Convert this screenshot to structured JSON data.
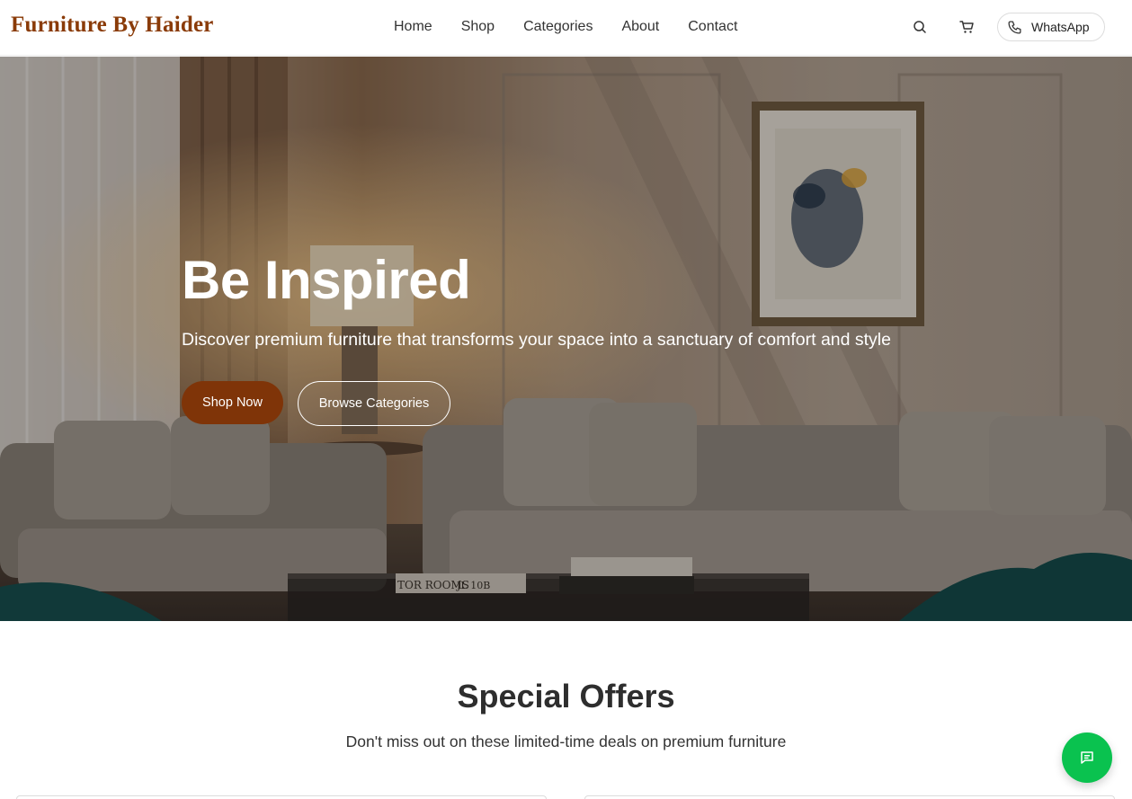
{
  "brand": "Furniture By Haider",
  "nav": {
    "items": [
      "Home",
      "Shop",
      "Categories",
      "About",
      "Contact"
    ]
  },
  "header": {
    "search_icon": "search-icon",
    "cart_icon": "cart-icon",
    "whatsapp_label": "WhatsApp",
    "whatsapp_icon": "phone-icon"
  },
  "hero": {
    "title": "Be Inspired",
    "subtitle": "Discover premium furniture that transforms your space into a sanctuary of comfort and style",
    "primary_button": "Shop Now",
    "secondary_button": "Browse Categories",
    "book_text_1": "TOR ROOMS",
    "book_text_2": "JL 10B"
  },
  "offers": {
    "title": "Special Offers",
    "subtitle": "Don't miss out on these limited-time deals on premium furniture"
  },
  "chat": {
    "icon": "chat-icon"
  },
  "colors": {
    "brand": "#8a3b08",
    "primary_button": "#7f3408",
    "chat_button": "#0ac24f"
  }
}
